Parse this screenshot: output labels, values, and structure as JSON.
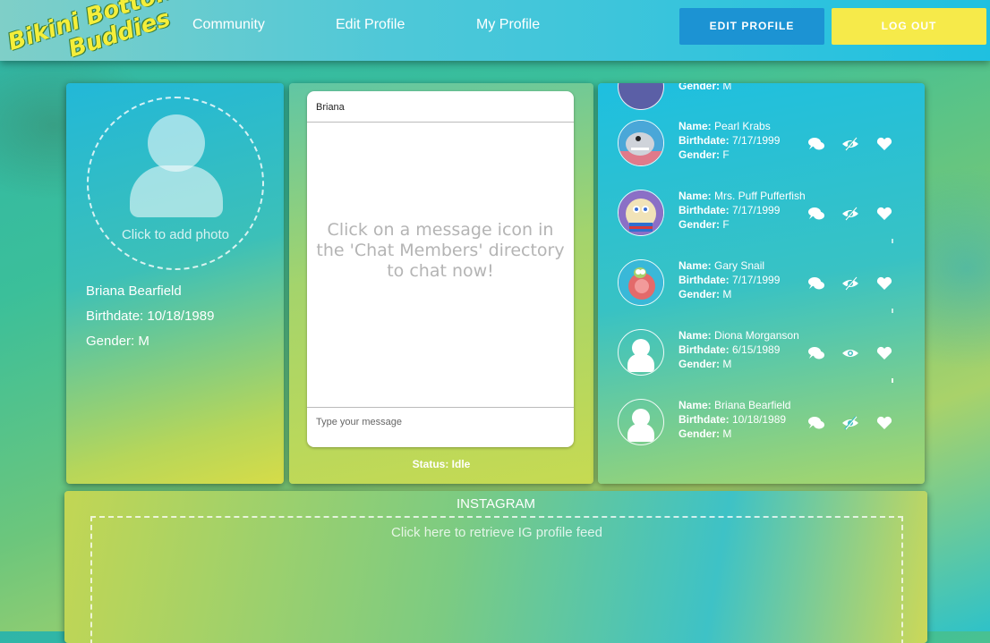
{
  "header": {
    "logo_line1": "Bikini Bottom",
    "logo_line2": "Buddies",
    "nav": [
      "Community",
      "Edit Profile",
      "My Profile"
    ],
    "edit_button": "EDIT PROFILE",
    "logout_button": "LOG OUT"
  },
  "profile": {
    "photo_prompt": "Click to add photo",
    "name": "Briana Bearfield",
    "birthdate": "Birthdate: 10/18/1989",
    "gender": "Gender: M"
  },
  "chat": {
    "recipient": "Briana",
    "empty_message": "Click on a message icon in the 'Chat Members' directory to chat now!",
    "input_placeholder": "Type your message",
    "status": "Status: Idle"
  },
  "members": {
    "labels": {
      "name": "Name:",
      "birthdate": "Birthdate:",
      "gender": "Gender:"
    },
    "partial_gender": "M",
    "items": [
      {
        "name": "Pearl Krabs",
        "birthdate": "7/17/1999",
        "gender": "F",
        "avatar": "whale-avatar",
        "seen": true
      },
      {
        "name": "Mrs. Puff Pufferfish",
        "birthdate": "7/17/1999",
        "gender": "F",
        "avatar": "pufferfish-avatar",
        "seen": true
      },
      {
        "name": "Gary Snail",
        "birthdate": "7/17/1999",
        "gender": "M",
        "avatar": "snail-avatar",
        "seen": true
      },
      {
        "name": "Diona Morganson",
        "birthdate": "6/15/1989",
        "gender": "M",
        "avatar": "default-avatar",
        "seen": false
      },
      {
        "name": "Briana Bearfield",
        "birthdate": "10/18/1989",
        "gender": "M",
        "avatar": "default-avatar",
        "seen": true
      }
    ]
  },
  "instagram": {
    "title": "INSTAGRAM",
    "prompt": "Click here to retrieve IG profile feed"
  },
  "colors": {
    "edit_button": "#1c93d3",
    "logout_button": "#f6ea4a",
    "logo": "#f4ee3a"
  }
}
